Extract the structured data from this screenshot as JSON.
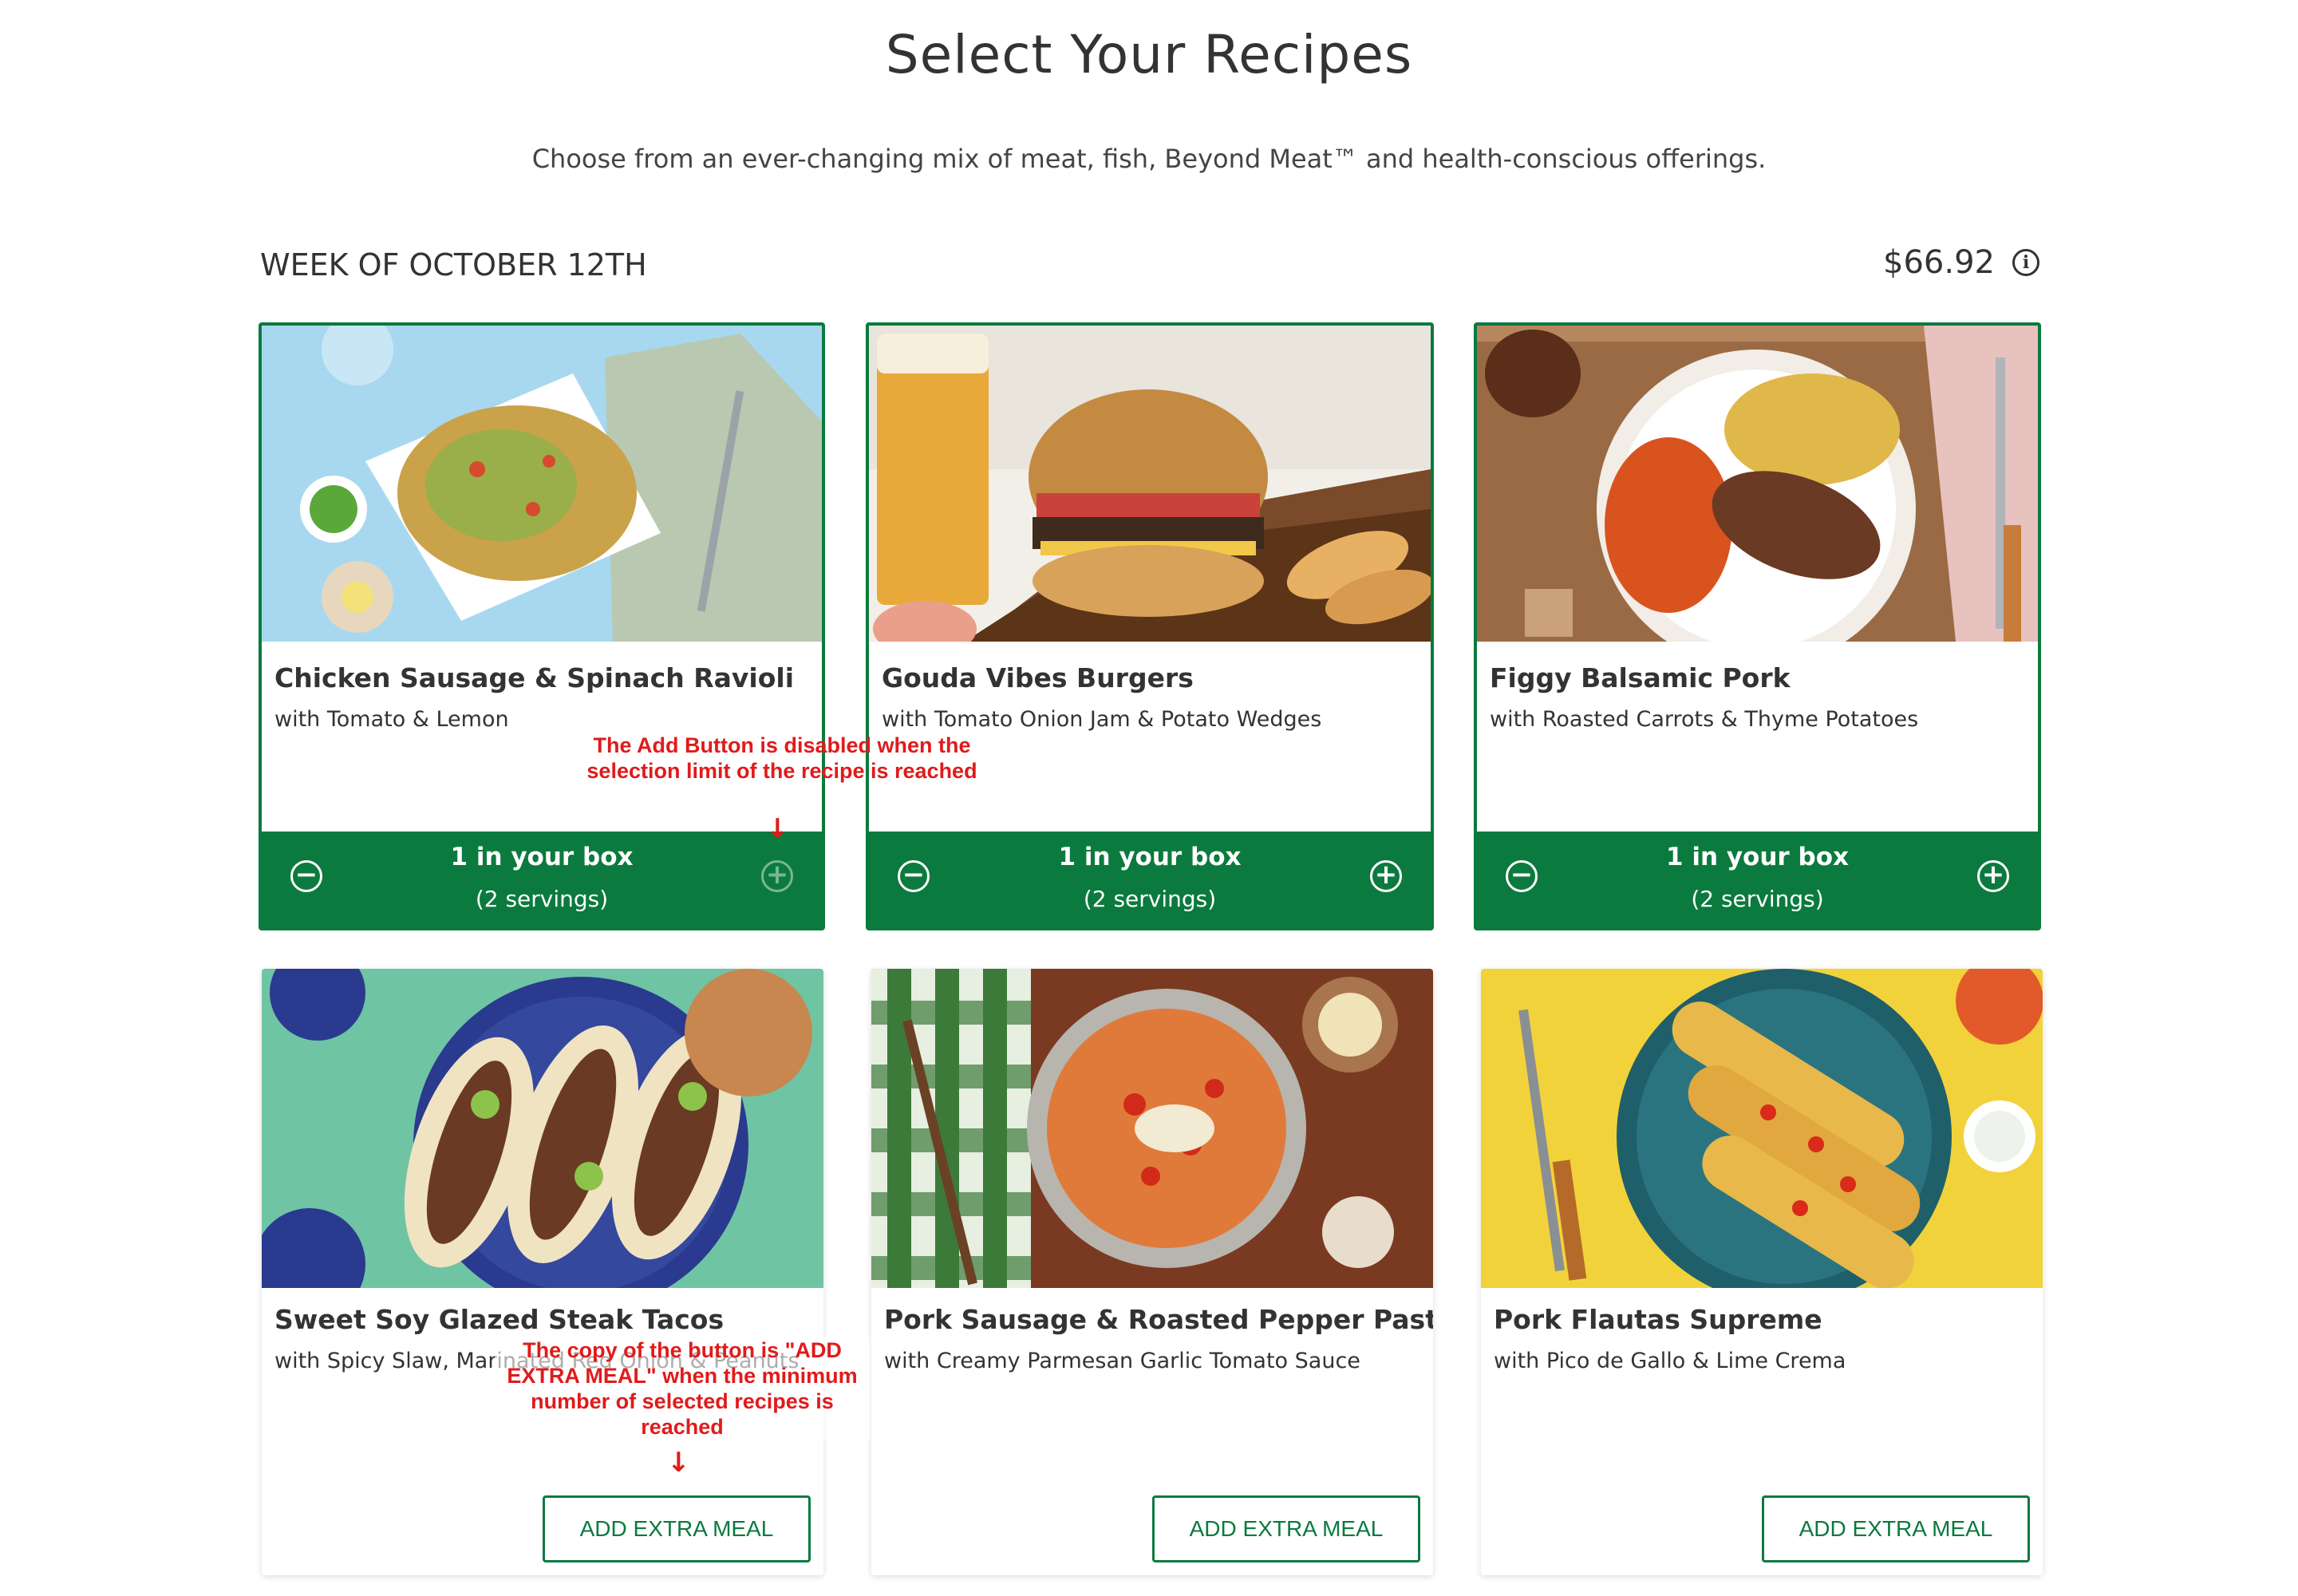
{
  "header": {
    "title": "Select Your Recipes",
    "subtitle": "Choose from an ever-changing mix of meat, fish, Beyond Meat™ and health-conscious offerings."
  },
  "week_bar": {
    "week_label": "WEEK OF OCTOBER 12TH",
    "price": "$66.92",
    "info_icon": "info-icon"
  },
  "recipes": [
    {
      "name": "Chicken Sausage & Spinach Ravioli",
      "subtitle": "with Tomato & Lemon",
      "selected": true,
      "count_label": "1 in your box",
      "servings_label": "(2 servings)",
      "add_disabled": true
    },
    {
      "name": "Gouda Vibes Burgers",
      "subtitle": "with Tomato Onion Jam & Potato Wedges",
      "selected": true,
      "count_label": "1 in your box",
      "servings_label": "(2 servings)",
      "add_disabled": false
    },
    {
      "name": "Figgy Balsamic Pork",
      "subtitle": "with Roasted Carrots & Thyme Potatoes",
      "selected": true,
      "count_label": "1 in your box",
      "servings_label": "(2 servings)",
      "add_disabled": false
    },
    {
      "name": "Sweet Soy Glazed Steak Tacos",
      "subtitle": "with Spicy Slaw, Marinated Red Onion & Peanuts",
      "selected": false,
      "button_label": "ADD EXTRA MEAL"
    },
    {
      "name": "Pork Sausage & Roasted Pepper Pasta",
      "subtitle": "with Creamy Parmesan Garlic Tomato Sauce",
      "selected": false,
      "button_label": "ADD EXTRA MEAL"
    },
    {
      "name": "Pork Flautas Supreme",
      "subtitle": "with Pico de Gallo & Lime Crema",
      "selected": false,
      "button_label": "ADD EXTRA MEAL"
    }
  ],
  "annotations": {
    "add_disabled_note": "The Add Button is disabled when the selection limit of the recipe is reached",
    "extra_meal_note": "The copy of the button is \"ADD EXTRA MEAL\" when the minimum number of selected recipes is reached"
  },
  "colors": {
    "brand_green": "#0b7a3e",
    "annotation_red": "#e01b1b"
  }
}
